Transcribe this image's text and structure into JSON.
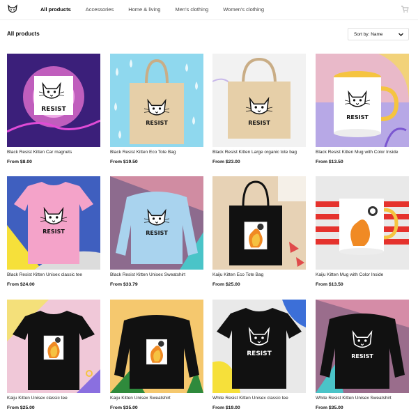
{
  "header": {
    "logo_icon": "cat-logo-icon",
    "nav": [
      {
        "label": "All products",
        "active": true
      },
      {
        "label": "Accessories",
        "active": false
      },
      {
        "label": "Home & living",
        "active": false
      },
      {
        "label": "Men's clothing",
        "active": false
      },
      {
        "label": "Women's clothing",
        "active": false
      }
    ],
    "cart_icon": "shopping-cart-icon"
  },
  "toolbar": {
    "title": "All products",
    "sort_label": "Sort by: Name"
  },
  "products": [
    {
      "name": "Black Resist Kitten Car magnets",
      "price": "From $8.00"
    },
    {
      "name": "Black Resist Kitten Eco Tote Bag",
      "price": "From $19.50"
    },
    {
      "name": "Black Resist Kitten Large organic tote bag",
      "price": "From $23.00"
    },
    {
      "name": "Black Resist Kitten Mug with Color Inside",
      "price": "From $13.50"
    },
    {
      "name": "Black Resist Kitten Unisex classic tee",
      "price": "From $24.00"
    },
    {
      "name": "Black Resist Kitten Unisex Sweatshirt",
      "price": "From $33.79"
    },
    {
      "name": "Kaiju Kitten Eco Tote Bag",
      "price": "From $25.00"
    },
    {
      "name": "Kaiju Kitten Mug with Color Inside",
      "price": "From $13.50"
    },
    {
      "name": "Kaiju Kitten Unisex classic tee",
      "price": "From $25.00"
    },
    {
      "name": "Kaiju Kitten Unisex Sweatshirt",
      "price": "From $35.00"
    },
    {
      "name": "White Resist Kitten Unisex classic tee",
      "price": "From $19.00"
    },
    {
      "name": "White Resist Kitten Unisex Sweatshirt",
      "price": "From $35.00"
    }
  ],
  "artwork_text": {
    "resist": "RESIST"
  }
}
